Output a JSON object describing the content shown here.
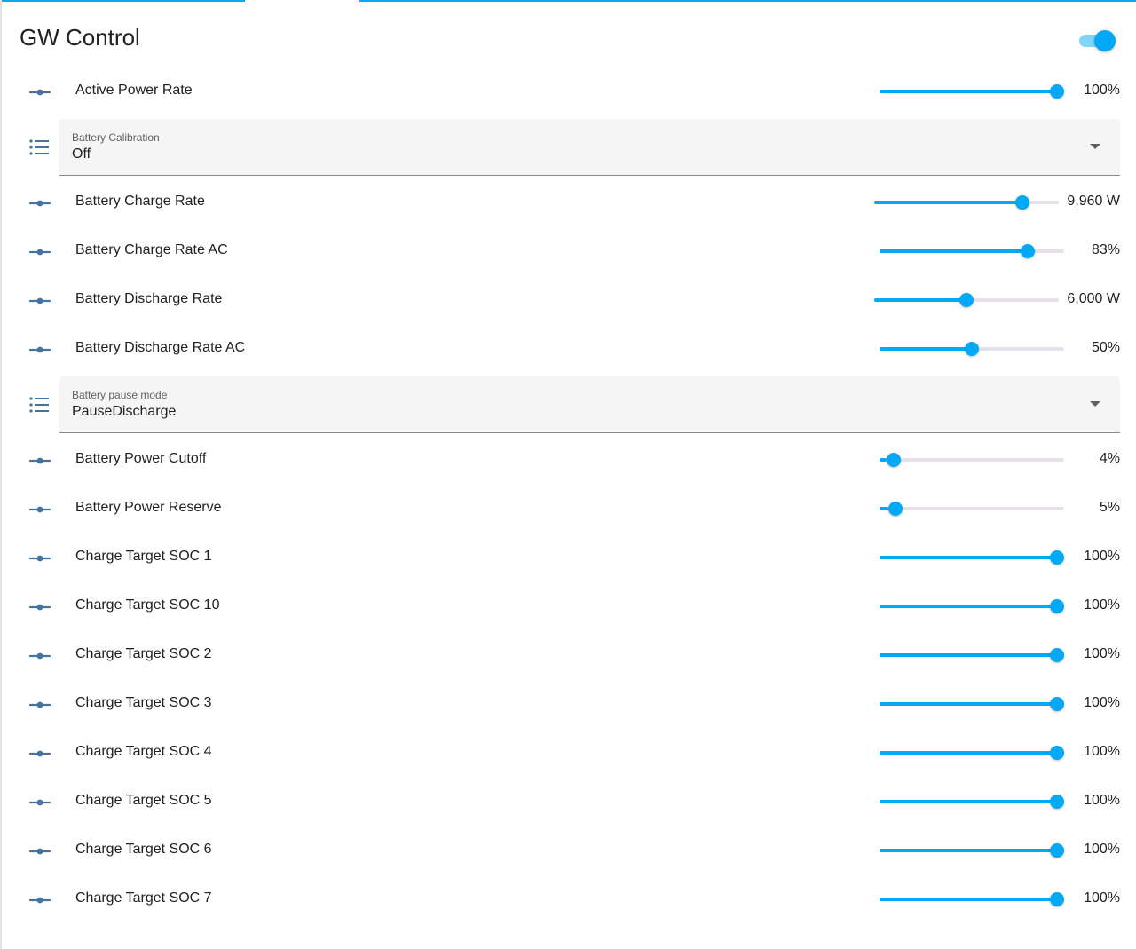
{
  "colors": {
    "accent": "#03a9f4",
    "icon": "#44739e",
    "rail": "#e6e1e8",
    "select_bg": "#f5f5f5"
  },
  "card": {
    "title": "GW Control",
    "toggle_on": true
  },
  "rows": [
    {
      "kind": "slider",
      "label": "Active Power Rate",
      "value": "100%",
      "level": 1.0,
      "icon": "slider-icon"
    },
    {
      "kind": "select",
      "label": "Battery Calibration",
      "value": "Off",
      "icon": "list-icon"
    },
    {
      "kind": "slider",
      "label": "Battery Charge Rate",
      "value": "9,960 W",
      "level": 0.83,
      "icon": "slider-icon"
    },
    {
      "kind": "slider",
      "label": "Battery Charge Rate AC",
      "value": "83%",
      "level": 0.83,
      "icon": "slider-icon"
    },
    {
      "kind": "slider",
      "label": "Battery Discharge Rate",
      "value": "6,000 W",
      "level": 0.5,
      "icon": "slider-icon"
    },
    {
      "kind": "slider",
      "label": "Battery Discharge Rate AC",
      "value": "50%",
      "level": 0.5,
      "icon": "slider-icon"
    },
    {
      "kind": "select",
      "label": "Battery pause mode",
      "value": "PauseDischarge",
      "icon": "list-icon"
    },
    {
      "kind": "slider",
      "label": "Battery Power Cutoff",
      "value": "4%",
      "level": 0.04,
      "icon": "slider-icon"
    },
    {
      "kind": "slider",
      "label": "Battery Power Reserve",
      "value": "5%",
      "level": 0.05,
      "icon": "slider-icon"
    },
    {
      "kind": "slider",
      "label": "Charge Target SOC 1",
      "value": "100%",
      "level": 1.0,
      "icon": "slider-icon"
    },
    {
      "kind": "slider",
      "label": "Charge Target SOC 10",
      "value": "100%",
      "level": 1.0,
      "icon": "slider-icon"
    },
    {
      "kind": "slider",
      "label": "Charge Target SOC 2",
      "value": "100%",
      "level": 1.0,
      "icon": "slider-icon"
    },
    {
      "kind": "slider",
      "label": "Charge Target SOC 3",
      "value": "100%",
      "level": 1.0,
      "icon": "slider-icon"
    },
    {
      "kind": "slider",
      "label": "Charge Target SOC 4",
      "value": "100%",
      "level": 1.0,
      "icon": "slider-icon"
    },
    {
      "kind": "slider",
      "label": "Charge Target SOC 5",
      "value": "100%",
      "level": 1.0,
      "icon": "slider-icon"
    },
    {
      "kind": "slider",
      "label": "Charge Target SOC 6",
      "value": "100%",
      "level": 1.0,
      "icon": "slider-icon"
    },
    {
      "kind": "slider",
      "label": "Charge Target SOC 7",
      "value": "100%",
      "level": 1.0,
      "icon": "slider-icon"
    }
  ]
}
